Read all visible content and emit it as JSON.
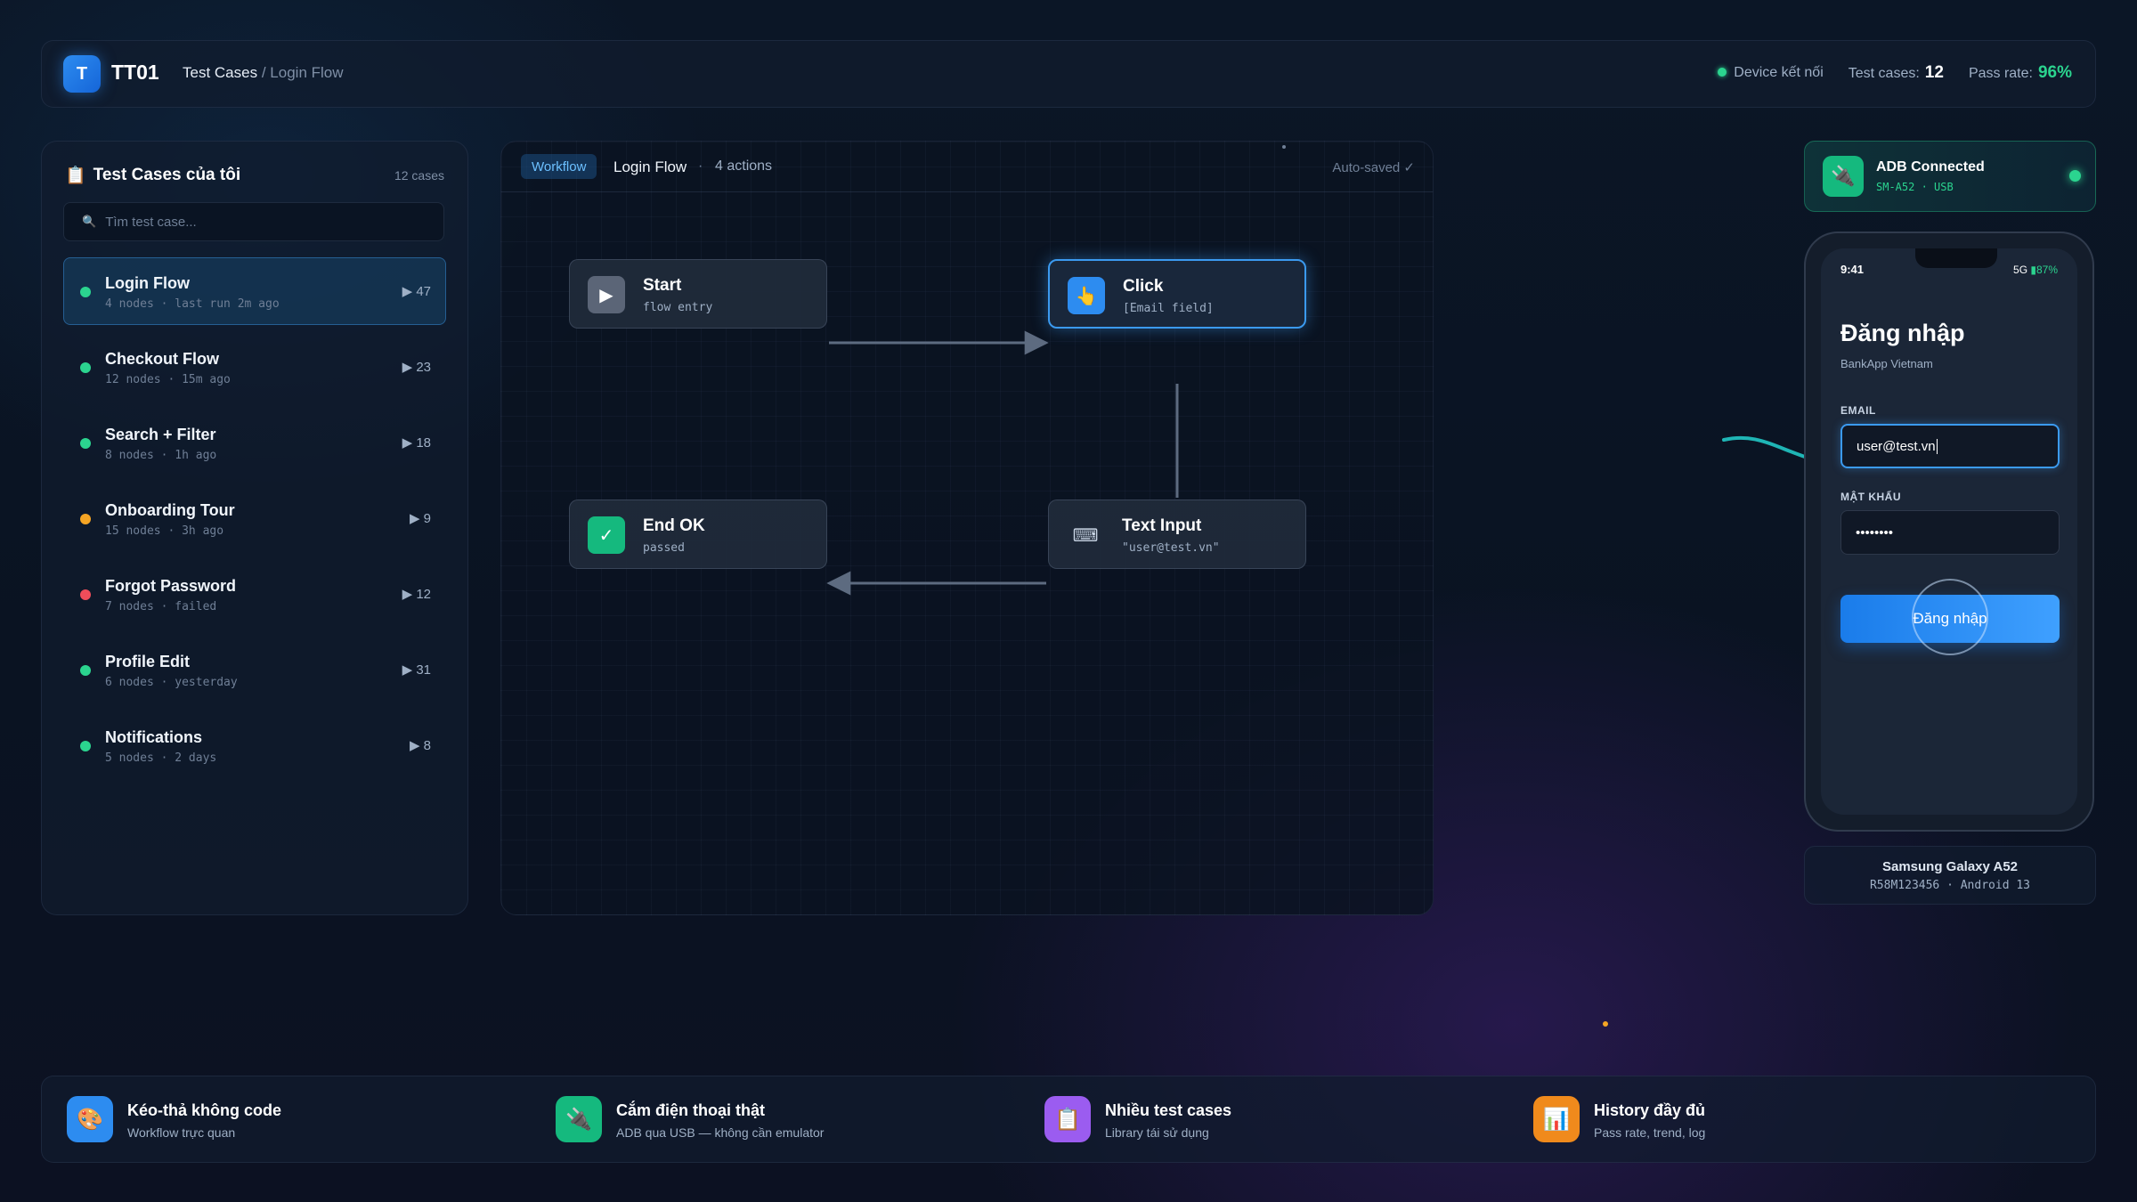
{
  "header": {
    "logo_letter": "T",
    "brand": "TT01",
    "breadcrumb_root": "Test Cases",
    "breadcrumb_sep": "/",
    "breadcrumb_current": "Login Flow",
    "device_status": "Device kết nối",
    "test_cases_label": "Test cases:",
    "test_cases_value": "12",
    "pass_rate_label": "Pass rate:",
    "pass_rate_value": "96%"
  },
  "sidebar": {
    "title": "Test Cases của tôi",
    "title_icon": "clipboard-icon",
    "count": "12 cases",
    "search_placeholder": "Tìm test case...",
    "items": [
      {
        "name": "Login Flow",
        "meta": "4 nodes · last run 2m ago",
        "runs": "▶ 47",
        "status": "#2bd48f",
        "active": true
      },
      {
        "name": "Checkout Flow",
        "meta": "12 nodes · 15m ago",
        "runs": "▶ 23",
        "status": "#2bd48f"
      },
      {
        "name": "Search + Filter",
        "meta": "8 nodes · 1h ago",
        "runs": "▶ 18",
        "status": "#2bd48f"
      },
      {
        "name": "Onboarding Tour",
        "meta": "15 nodes · 3h ago",
        "runs": "▶ 9",
        "status": "#f5a524"
      },
      {
        "name": "Forgot Password",
        "meta": "7 nodes · failed",
        "runs": "▶ 12",
        "status": "#ef4d5a"
      },
      {
        "name": "Profile Edit",
        "meta": "6 nodes · yesterday",
        "runs": "▶ 31",
        "status": "#2bd48f"
      },
      {
        "name": "Notifications",
        "meta": "5 nodes · 2 days",
        "runs": "▶ 8",
        "status": "#2bd48f"
      }
    ]
  },
  "canvas": {
    "tag": "Workflow",
    "name": "Login Flow",
    "sep": "·",
    "actions": "4 actions",
    "saved": "Auto-saved ✓",
    "nodes": [
      {
        "title": "Start",
        "sub": "flow entry",
        "icon": "play-icon"
      },
      {
        "title": "Click",
        "sub": "[Email field]",
        "icon": "pointer-hand-icon"
      },
      {
        "title": "Text Input",
        "sub": "\"user@test.vn\"",
        "icon": "keyboard-icon"
      },
      {
        "title": "End OK",
        "sub": "passed",
        "icon": "checkmark-icon"
      }
    ]
  },
  "adb": {
    "title": "ADB Connected",
    "sub": "SM-A52 · USB",
    "icon": "usb-plug-icon"
  },
  "phone": {
    "time": "9:41",
    "network": "5G",
    "battery": "▮87%",
    "heading": "Đăng nhập",
    "subheading": "BankApp Vietnam",
    "email_label": "EMAIL",
    "email_value": "user@test.vn",
    "password_label": "MẬT KHẨU",
    "password_value": "••••••••",
    "button_label": "Đăng nhập"
  },
  "device": {
    "name": "Samsung Galaxy A52",
    "info": "R58M123456 · Android 13"
  },
  "features": [
    {
      "title": "Kéo-thả không code",
      "sub": "Workflow trực quan",
      "icon": "palette-icon",
      "color": "#2d8cf0"
    },
    {
      "title": "Cắm điện thoại thật",
      "sub": "ADB qua USB — không cần emulator",
      "icon": "usb-plug-icon",
      "color": "#15b97e"
    },
    {
      "title": "Nhiều test cases",
      "sub": "Library tái sử dụng",
      "icon": "clipboard-icon",
      "color": "#9b5cf0"
    },
    {
      "title": "History đầy đủ",
      "sub": "Pass rate, trend, log",
      "icon": "bar-chart-icon",
      "color": "#f08a1c"
    }
  ]
}
